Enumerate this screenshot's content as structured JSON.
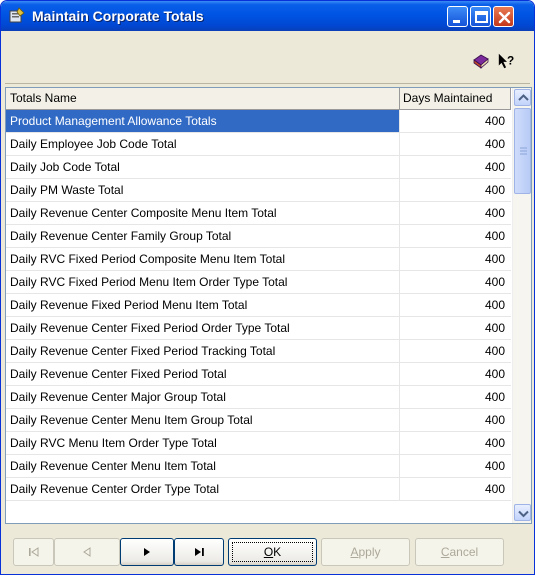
{
  "window": {
    "title": "Maintain Corporate Totals"
  },
  "toolbar": {
    "icons": [
      "book-icon",
      "help-pointer-icon"
    ]
  },
  "grid": {
    "columns": [
      "Totals Name",
      "Days Maintained"
    ],
    "rows": [
      {
        "name": "Product Management Allowance Totals",
        "days": "400",
        "selected": true
      },
      {
        "name": "Daily Employee Job Code Total",
        "days": "400"
      },
      {
        "name": "Daily Job Code Total",
        "days": "400"
      },
      {
        "name": "Daily PM Waste Total",
        "days": "400"
      },
      {
        "name": "Daily Revenue Center Composite Menu Item Total",
        "days": "400"
      },
      {
        "name": "Daily Revenue Center Family Group Total",
        "days": "400"
      },
      {
        "name": "Daily RVC Fixed Period Composite Menu Item Total",
        "days": "400"
      },
      {
        "name": "Daily RVC Fixed Period Menu Item Order Type Total",
        "days": "400"
      },
      {
        "name": "Daily Revenue Fixed Period Menu Item Total",
        "days": "400"
      },
      {
        "name": "Daily Revenue Center Fixed Period Order Type Total",
        "days": "400"
      },
      {
        "name": "Daily Revenue Center Fixed Period Tracking Total",
        "days": "400"
      },
      {
        "name": "Daily Revenue Center Fixed Period Total",
        "days": "400"
      },
      {
        "name": "Daily Revenue Center Major Group Total",
        "days": "400"
      },
      {
        "name": "Daily Revenue Center Menu Item Group Total",
        "days": "400"
      },
      {
        "name": "Daily RVC Menu Item Order Type Total",
        "days": "400"
      },
      {
        "name": "Daily Revenue Center Menu Item Total",
        "days": "400"
      },
      {
        "name": "Daily Revenue Center Order Type Total",
        "days": "400"
      }
    ]
  },
  "buttons": {
    "ok": {
      "label": "OK",
      "mnemonic": "O",
      "rest": "K"
    },
    "apply": {
      "label": "Apply",
      "mnemonic": "A",
      "rest": "pply"
    },
    "cancel": {
      "label": "Cancel",
      "mnemonic": "C",
      "rest": "ancel"
    }
  },
  "colors": {
    "selection": "#316ac5",
    "titlebar": "#0054e3",
    "close": "#c3391a"
  }
}
